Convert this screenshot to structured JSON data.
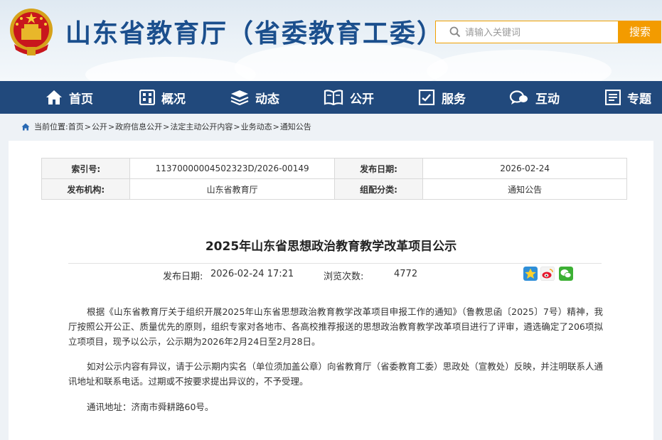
{
  "header": {
    "site_title": "山东省教育厅（省委教育工委）",
    "search_placeholder": "请输入关键词",
    "search_button": "搜索"
  },
  "nav": {
    "items": [
      {
        "label": "首页",
        "icon": "home-icon"
      },
      {
        "label": "概况",
        "icon": "building-icon"
      },
      {
        "label": "动态",
        "icon": "layers-icon"
      },
      {
        "label": "公开",
        "icon": "book-icon"
      },
      {
        "label": "服务",
        "icon": "service-icon"
      },
      {
        "label": "互动",
        "icon": "chat-icon"
      },
      {
        "label": "专题",
        "icon": "topic-icon"
      }
    ]
  },
  "breadcrumb": {
    "prefix": "当前位置:",
    "items": [
      "首页",
      "公开",
      "政府信息公开",
      "法定主动公开内容",
      "业务动态",
      "通知公告"
    ],
    "separator": ">"
  },
  "meta": {
    "index_label": "索引号:",
    "index_value": "11370000004502323D/2026-00149",
    "date_label": "发布日期:",
    "date_value": "2026-02-24",
    "org_label": "发布机构:",
    "org_value": "山东省教育厅",
    "category_label": "组配分类:",
    "category_value": "通知公告"
  },
  "article": {
    "title": "2025年山东省思想政治教育教学改革项目公示",
    "publish_label": "发布日期:",
    "publish_value": "2026-02-24 17:21",
    "views_label": "浏览次数:",
    "views_value": "4772",
    "share_icons": [
      "qzone-icon",
      "weibo-icon",
      "wechat-icon"
    ],
    "paragraphs": [
      "根据《山东省教育厅关于组织开展2025年山东省思想政治教育教学改革项目申报工作的通知》（鲁教思函〔2025〕7号）精神，我厅按照公开公正、质量优先的原则，组织专家对各地市、各高校推荐报送的思想政治教育教学改革项目进行了评审，遴选确定了206项拟立项项目，现予以公示，公示期为2026年2月24日至2月28日。",
      "如对公示内容有异议，请于公示期内实名（单位须加盖公章）向省教育厅（省委教育工委）思政处（宣教处）反映，并注明联系人通讯地址和联系电话。过期或不按要求提出异议的，不予受理。",
      "通讯地址：济南市舜耕路60号。"
    ]
  },
  "colors": {
    "nav_bg": "#21497c",
    "title_blue": "#1b4f8d",
    "search_orange": "#f39b00"
  }
}
